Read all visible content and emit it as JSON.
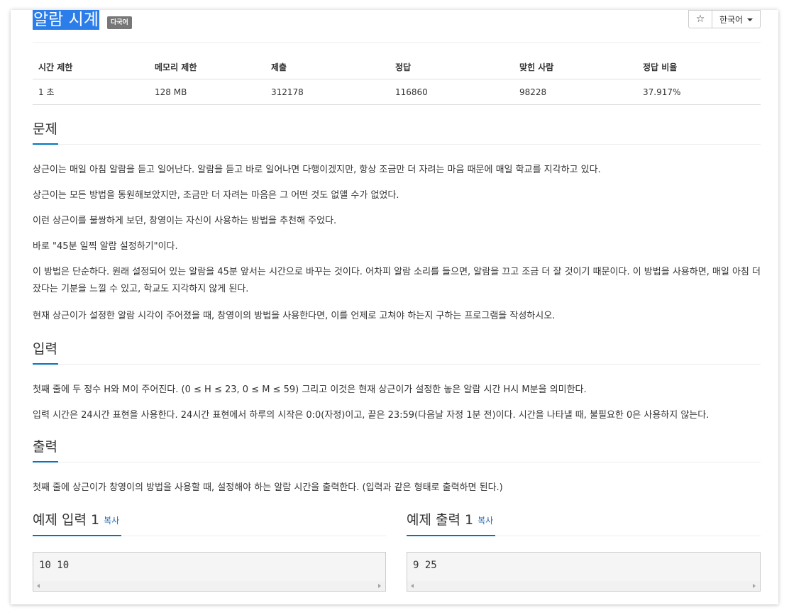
{
  "header": {
    "title": "알람 시계",
    "lang_badge": "다국어",
    "star_icon": "☆",
    "language_button": "한국어"
  },
  "stats": {
    "headers": [
      "시간 제한",
      "메모리 제한",
      "제출",
      "정답",
      "맞힌 사람",
      "정답 비율"
    ],
    "values": [
      "1 초",
      "128 MB",
      "312178",
      "116860",
      "98228",
      "37.917%"
    ]
  },
  "problem": {
    "title": "문제",
    "paragraphs": [
      "상근이는 매일 아침 알람을 듣고 일어난다. 알람을 듣고 바로 일어나면 다행이겠지만, 항상 조금만 더 자려는 마음 때문에 매일 학교를 지각하고 있다.",
      "상근이는 모든 방법을 동원해보았지만, 조금만 더 자려는 마음은 그 어떤 것도 없앨 수가 없었다.",
      "이런 상근이를 불쌍하게 보던, 창영이는 자신이 사용하는 방법을 추천해 주었다.",
      "바로 \"45분 일찍 알람 설정하기\"이다.",
      "이 방법은 단순하다. 원래 설정되어 있는 알람을 45분 앞서는 시간으로 바꾸는 것이다. 어차피 알람 소리를 들으면, 알람을 끄고 조금 더 잘 것이기 때문이다. 이 방법을 사용하면, 매일 아침 더 잤다는 기분을 느낄 수 있고, 학교도 지각하지 않게 된다.",
      "현재 상근이가 설정한 알람 시각이 주어졌을 때, 창영이의 방법을 사용한다면, 이를 언제로 고쳐야 하는지 구하는 프로그램을 작성하시오."
    ]
  },
  "input": {
    "title": "입력",
    "paragraphs": [
      "첫째 줄에 두 정수 H와 M이 주어진다. (0 ≤ H ≤ 23, 0 ≤ M ≤ 59) 그리고 이것은 현재 상근이가 설정한 놓은 알람 시간 H시 M분을 의미한다.",
      "입력 시간은 24시간 표현을 사용한다. 24시간 표현에서 하루의 시작은 0:0(자정)이고, 끝은 23:59(다음날 자정 1분 전)이다. 시간을 나타낼 때, 불필요한 0은 사용하지 않는다."
    ]
  },
  "output": {
    "title": "출력",
    "paragraphs": [
      "첫째 줄에 상근이가 창영이의 방법을 사용할 때, 설정해야 하는 알람 시간을 출력한다. (입력과 같은 형태로 출력하면 된다.)"
    ]
  },
  "sample_input": {
    "title": "예제 입력 1",
    "copy": "복사",
    "content": "10 10"
  },
  "sample_output": {
    "title": "예제 출력 1",
    "copy": "복사",
    "content": "9 25"
  }
}
